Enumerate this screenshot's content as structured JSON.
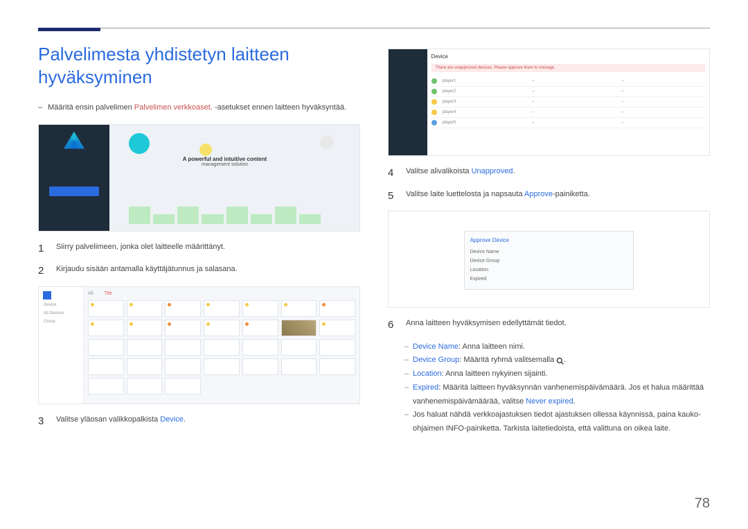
{
  "title": "Palvelimesta yhdistetyn laitteen hyväksyminen",
  "intro": {
    "pre": "Määritä ensin palvelimen ",
    "highlight": "Palvelimen verkkoaset.",
    "post": " -asetukset ennen laitteen hyväksyntää."
  },
  "fig_a_slogan_top": "A powerful and intuitive content",
  "fig_a_slogan_bottom": "management solution",
  "fig_b": {
    "side_title": "Device",
    "side_items": [
      "All Devices",
      "Group"
    ],
    "tab1": "All",
    "tab2": "Tile"
  },
  "fig_c": {
    "title": "Device",
    "warn": "There are unapproved devices. Please approve them to manage.",
    "rows": [
      "player1",
      "player2",
      "player3",
      "player4",
      "player5"
    ]
  },
  "fig_d": {
    "modal_title": "Approve Device",
    "lines": [
      "Device Name",
      "Device Group",
      "Location",
      "Expired"
    ]
  },
  "steps": {
    "s1": "Siirry palvelimeen, jonka olet laitteelle määrittänyt.",
    "s2": "Kirjaudu sisään antamalla käyttäjätunnus ja salasana.",
    "s3_pre": "Valitse yläosan valikkopalkista ",
    "s3_hl": "Device",
    "s3_post": ".",
    "s4_pre": "Valitse alivalikoista ",
    "s4_hl": "Unapproved",
    "s4_post": ".",
    "s5_pre": "Valitse laite luettelosta ja napsauta ",
    "s5_hl": "Approve",
    "s5_post": "-painiketta.",
    "s6": "Anna laitteen hyväksymisen edellyttämät tiedot."
  },
  "sub": {
    "dn_label": "Device Name",
    "dn_text": ": Anna laitteen nimi.",
    "dg_label": "Device Group",
    "dg_text": ": Määritä ryhmä valitsemalla ",
    "dg_post": ".",
    "loc_label": "Location",
    "loc_text": ": Anna laitteen nykyinen sijainti.",
    "exp_label": "Expired",
    "exp_text": ": Määritä laitteen hyväksynnän vanhenemispäivämäärä. Jos et halua määrittää vanhenemispäivämäärää, valitse ",
    "exp_hl": "Never expired",
    "exp_post": ".",
    "note": "Jos haluat nähdä verkkoajastuksen tiedot ajastuksen ollessa käynnissä, paina kauko-ohjaimen INFO-painiketta. Tarkista laitetiedoista, että valittuna on oikea laite."
  },
  "page_number": "78"
}
